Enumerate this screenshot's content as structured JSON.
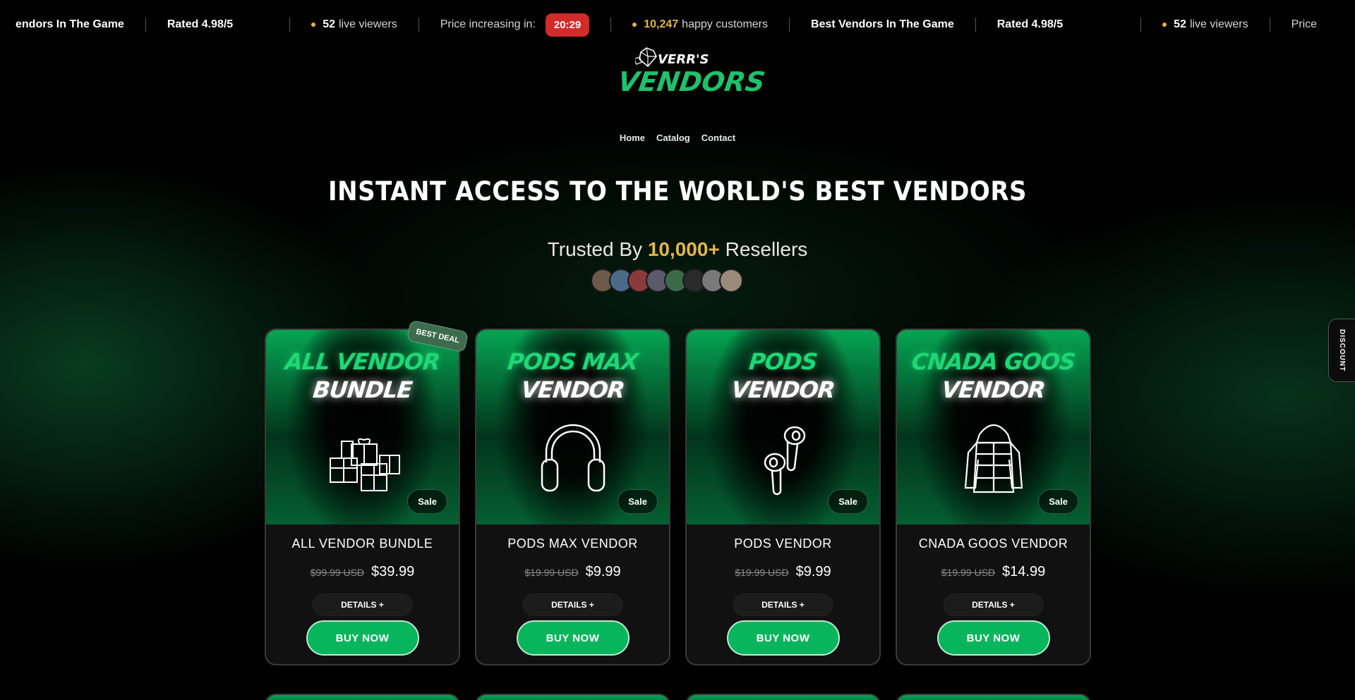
{
  "ticker": {
    "items": [
      {
        "type": "bold",
        "text": "Best Vendors In The Game"
      },
      {
        "type": "bold",
        "text": "Rated 4.98/5"
      },
      {
        "type": "viewers",
        "count": "52",
        "text": "live viewers"
      },
      {
        "type": "timer",
        "text": "Price increasing in:",
        "time": "20:29"
      },
      {
        "type": "customers",
        "count": "10,247",
        "text": "happy customers"
      },
      {
        "type": "bold",
        "text": "Best Vendors In The Game"
      },
      {
        "type": "bold",
        "text": "Rated 4.98/5"
      },
      {
        "type": "viewers",
        "count": "52",
        "text": "live viewers"
      },
      {
        "type": "timer",
        "text": "Price increasing in:",
        "time": "20:29"
      }
    ],
    "first_item_visible": "endors In The Game",
    "second_item": "Rated 4.98/5",
    "third_count": "52",
    "third_text": "live viewers",
    "timer_label": "Price increasing in:",
    "timer_value": "20:29",
    "customers_count": "10,247",
    "customers_text": "happy customers",
    "repeat_title": "Best Vendors In The Game",
    "repeat_rated": "Rated 4.98/5",
    "repeat_count": "52",
    "repeat_viewers": "live viewers",
    "repeat_price": "Price"
  },
  "logo": {
    "top": "VERR'S",
    "main": "VENDORS"
  },
  "nav": [
    {
      "label": "Home"
    },
    {
      "label": "Catalog"
    },
    {
      "label": "Contact"
    }
  ],
  "hero": {
    "title": "INSTANT ACCESS TO THE WORLD'S BEST VENDORS",
    "trusted_prefix": "Trusted By",
    "trusted_count": "10,000+",
    "trusted_suffix": "Resellers"
  },
  "avatars_count": 8,
  "cards": [
    {
      "line1": "ALL VENDOR",
      "line2": "BUNDLE",
      "icon": "gift-boxes-icon",
      "badge": "Sale",
      "best_deal": "BEST DEAL",
      "name": "ALL VENDOR BUNDLE",
      "old_price": "$99.99 USD",
      "price": "$39.99",
      "details": "DETAILS +",
      "buy": "BUY NOW"
    },
    {
      "line1": "PODS MAX",
      "line2": "VENDOR",
      "icon": "headphones-icon",
      "badge": "Sale",
      "name": "PODS MAX VENDOR",
      "old_price": "$19.99 USD",
      "price": "$9.99",
      "details": "DETAILS +",
      "buy": "BUY NOW"
    },
    {
      "line1": "PODS",
      "line2": "VENDOR",
      "icon": "earbuds-icon",
      "badge": "Sale",
      "name": "PODS VENDOR",
      "old_price": "$19.99 USD",
      "price": "$9.99",
      "details": "DETAILS +",
      "buy": "BUY NOW"
    },
    {
      "line1": "CNADA GOOS",
      "line2": "VENDOR",
      "icon": "puffer-jacket-icon",
      "badge": "Sale",
      "name": "CNADA GOOS VENDOR",
      "old_price": "$19.99 USD",
      "price": "$14.99",
      "details": "DETAILS +",
      "buy": "BUY NOW"
    }
  ],
  "discount_tab": "DISCOUNT",
  "colors": {
    "accent": "#08b55c",
    "gold": "#e2b64c",
    "timer_red": "#d32a2a"
  }
}
